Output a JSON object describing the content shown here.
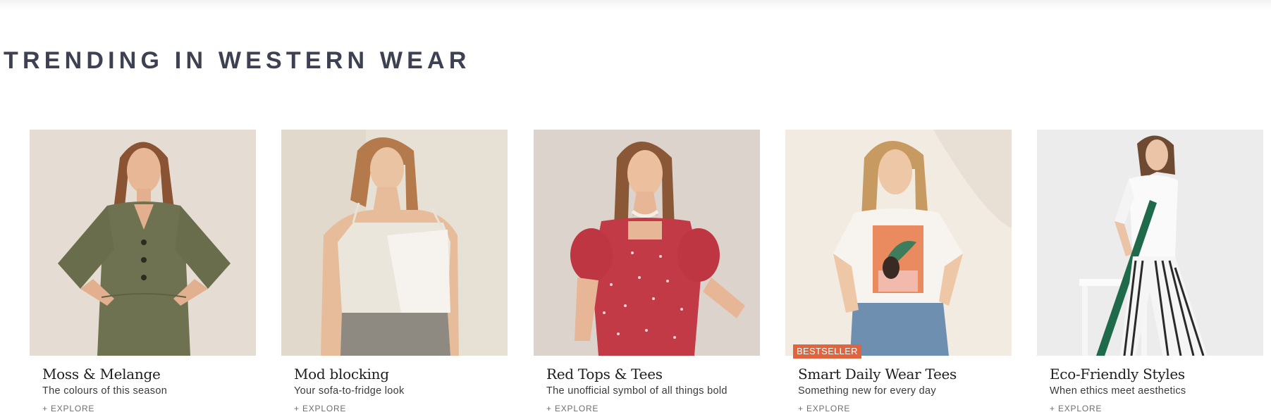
{
  "section": {
    "title": "TRENDING IN WESTERN WEAR"
  },
  "cards": [
    {
      "title": "Moss & Melange",
      "subtitle": "The colours of this season",
      "cta": "+ EXPLORE",
      "image": "woman-in-olive-green-dress-photo",
      "bg_color": "#e5ddd3",
      "garment_color": "#6f7250"
    },
    {
      "title": "Mod blocking",
      "subtitle": "Your sofa-to-fridge look",
      "cta": "+ EXPLORE",
      "image": "woman-in-colour-block-camisole-photo",
      "bg_color": "#e7e1d5",
      "garment_color": "#ebe6dc"
    },
    {
      "title": "Red Tops & Tees",
      "subtitle": "The unofficial symbol of all things bold",
      "cta": "+ EXPLORE",
      "image": "woman-in-red-floral-top-photo",
      "bg_color": "#dcd4cc",
      "garment_color": "#c33a47"
    },
    {
      "title": "Smart Daily Wear Tees",
      "subtitle": "Something new for every day",
      "cta": "+ EXPLORE",
      "badge": "BESTSELLER",
      "badge_color": "#e0653f",
      "image": "woman-in-printed-white-tee-photo",
      "bg_color": "#f1ebe2",
      "garment_color": "#f7f3ef"
    },
    {
      "title": "Eco-Friendly Styles",
      "subtitle": "When ethics meet aesthetics",
      "cta": "+ EXPLORE",
      "image": "woman-in-striped-trousers-photo",
      "bg_color": "#ececec",
      "garment_color": "#fafafa"
    }
  ]
}
